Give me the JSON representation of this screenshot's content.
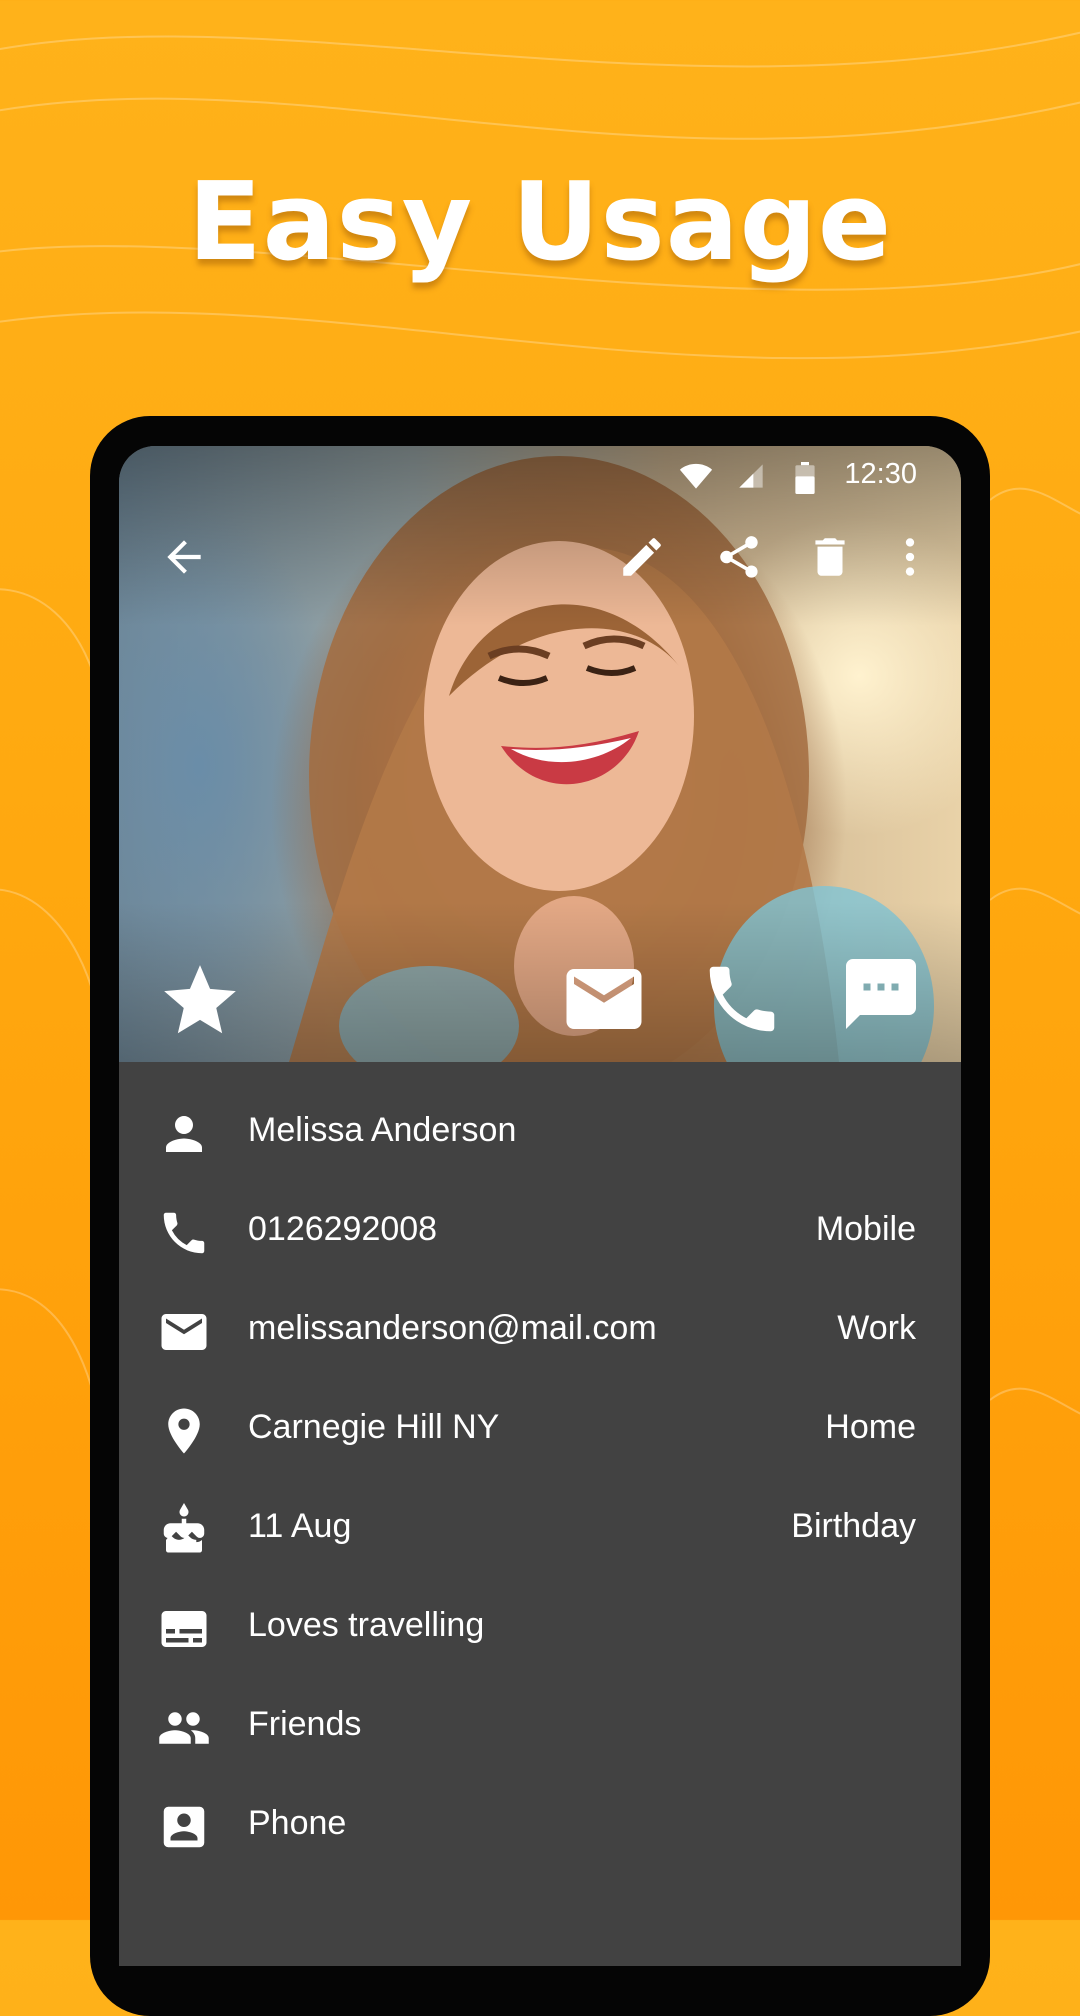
{
  "headline": "Easy Usage",
  "colors": {
    "background_top": "#FFB21A",
    "background_bottom": "#FF9706",
    "details_background": "#424242",
    "text": "#FFFFFF"
  },
  "status_bar": {
    "time": "12:30",
    "icons": [
      "wifi-icon",
      "signal-icon",
      "battery-icon"
    ]
  },
  "toolbar": {
    "icons": [
      "back-arrow-icon",
      "edit-icon",
      "share-icon",
      "delete-icon",
      "more-vert-icon"
    ]
  },
  "photo_actions": {
    "icons": [
      "star-icon",
      "email-icon",
      "call-icon",
      "message-icon"
    ]
  },
  "contact": {
    "name": "Melissa Anderson",
    "phone": {
      "value": "0126292008",
      "label": "Mobile"
    },
    "email": {
      "value": "melissanderson@mail.com",
      "label": "Work"
    },
    "address": {
      "value": "Carnegie Hill NY",
      "label": "Home"
    },
    "event": {
      "value": "11 Aug",
      "label": "Birthday"
    },
    "note": "Loves travelling",
    "group": "Friends",
    "source": "Phone"
  }
}
